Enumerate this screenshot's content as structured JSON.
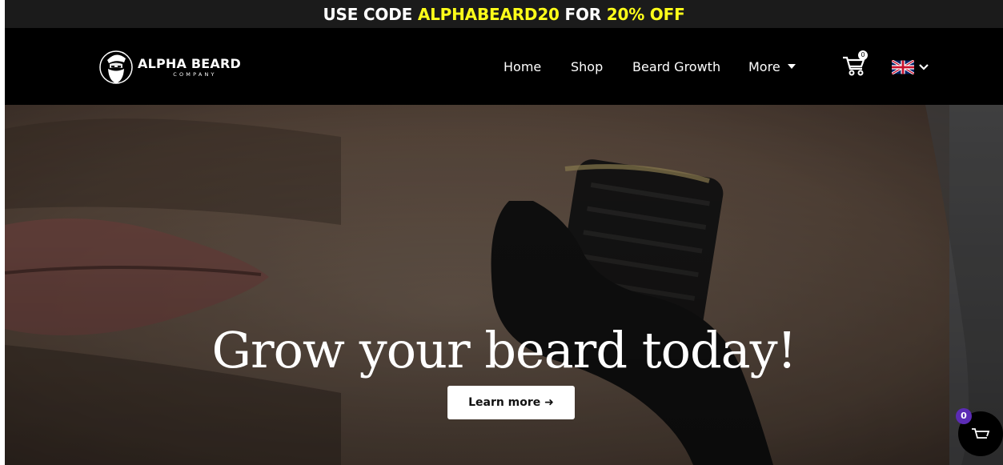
{
  "promo": {
    "prefix": "USE CODE ",
    "code": "ALPHABEARD20",
    "middle": " FOR ",
    "discount": "20% OFF",
    "highlight_color": "#ffff1a"
  },
  "brand": {
    "name": "ALPHA BEARD",
    "tagline": "COMPANY",
    "icon": "bearded-man-logo-icon"
  },
  "nav": {
    "items": [
      {
        "label": "Home"
      },
      {
        "label": "Shop"
      },
      {
        "label": "Beard Growth"
      },
      {
        "label": "More",
        "icon": "caret-down-icon"
      }
    ]
  },
  "cart": {
    "count": "0",
    "icon": "cart-icon"
  },
  "language": {
    "flag": "uk-flag-icon",
    "icon": "chevron-down-icon"
  },
  "hero": {
    "headline": "Grow your beard today!",
    "cta_label": "Learn more ➜"
  },
  "floating_cart": {
    "count": "0",
    "icon": "cart-icon",
    "badge_color": "#5b2bb5"
  }
}
